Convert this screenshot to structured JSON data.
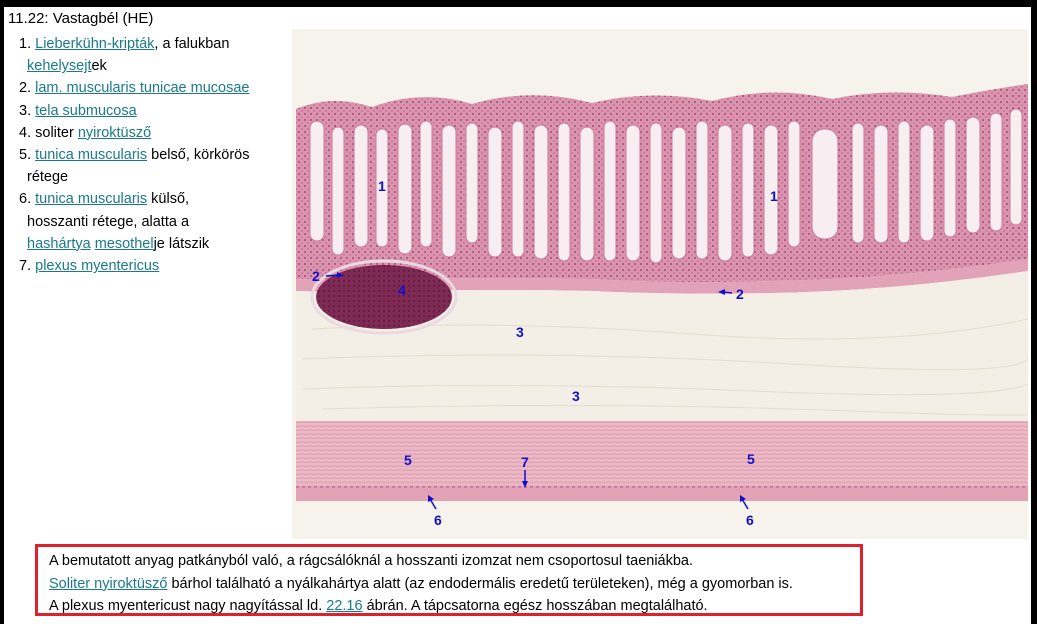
{
  "title": "11.22: Vastagbél (HE)",
  "legend": {
    "item1": {
      "num": "1.",
      "link1": "Lieberkühn-kripták",
      "text1": ", a falukban",
      "link2": "kehelysejt",
      "text2": "ek"
    },
    "item2": {
      "num": "2.",
      "link": "lam. muscularis tunicae mucosae"
    },
    "item3": {
      "num": "3.",
      "link": "tela submucosa"
    },
    "item4": {
      "num": "4.",
      "text": "soliter",
      "link": "nyiroktüsző"
    },
    "item5": {
      "num": "5.",
      "link": "tunica muscularis",
      "text": "belső, körkörös",
      "text2": "rétege"
    },
    "item6": {
      "num": "6.",
      "link1": "tunica muscularis",
      "text1": "külső,",
      "text2": "hosszanti rétege, alatta a",
      "link2": "hashártya",
      "link3": "mesothel",
      "text3": "je látszik"
    },
    "item7": {
      "num": "7.",
      "link": "plexus myentericus"
    }
  },
  "figure": {
    "labels": {
      "crypt_left": "1",
      "crypt_right": "1",
      "musc_mucosae_left": "2",
      "musc_mucosae_right": "2",
      "submucosa_top": "3",
      "submucosa_mid": "3",
      "follicle": "4",
      "circular_left": "5",
      "circular_right": "5",
      "longitudinal_left": "6",
      "longitudinal_right": "6",
      "plexus": "7"
    },
    "colors": {
      "mucosa": "#d98aa6",
      "crypt_lumen": "#f7eef2",
      "follicle": "#8b2f5c",
      "submucosa": "#f3efe6",
      "muscle": "#eab3c1",
      "label": "#1010cc"
    }
  },
  "note": {
    "line1": "A bemutatott anyag patkányból való, a rágcsálóknál a hosszanti izomzat nem csoportosul taeniákba.",
    "line2_link": "Soliter nyiroktüsző",
    "line2_text": " bárhol található a nyálkahártya alatt (az endodermális eredetű területeken), még a gyomorban is.",
    "line3_text1": "A plexus myentericust nagy nagyítással ld. ",
    "line3_link": "22.16",
    "line3_text2": " ábrán. A tápcsatorna egész hosszában megtalálható."
  }
}
